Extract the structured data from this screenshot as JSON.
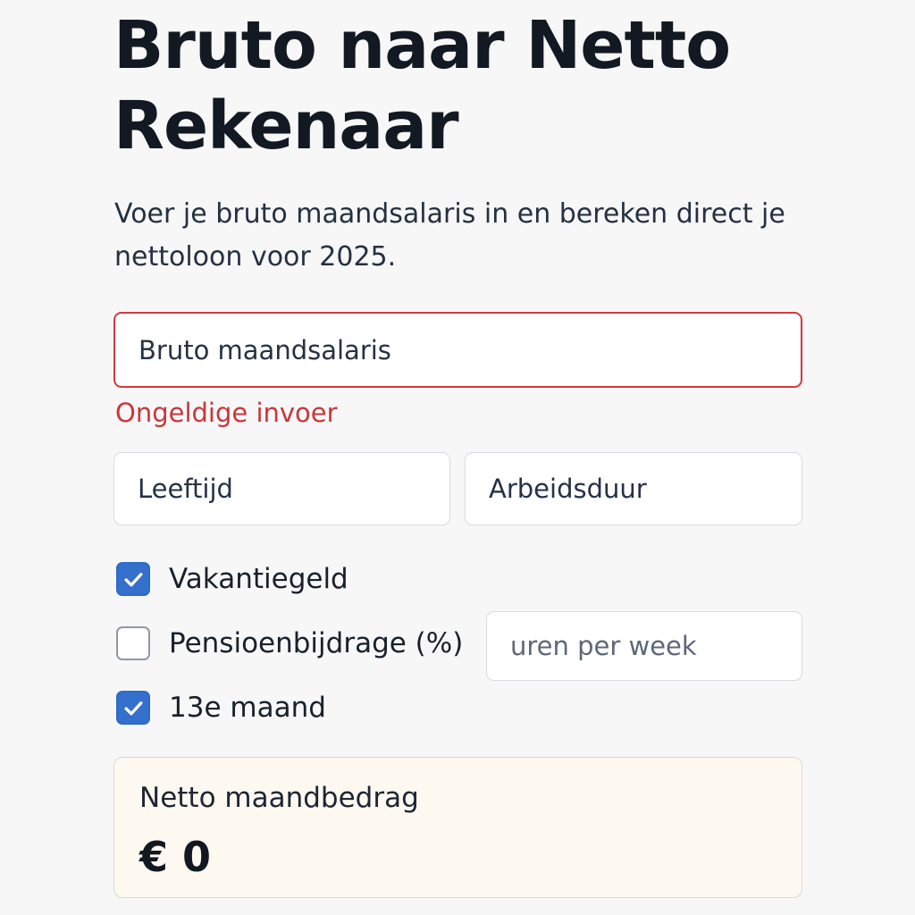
{
  "header": {
    "title": "Bruto naar Netto Rekenaar",
    "subtitle": "Voer je bruto maandsalaris in en bereken direct je nettoloon voor 2025."
  },
  "form": {
    "gross_salary": {
      "placeholder": "Bruto maandsalaris",
      "state": "error",
      "error_message": "Ongeldige invoer"
    },
    "age": {
      "placeholder": "Leeftijd"
    },
    "work_duration": {
      "placeholder": "Arbeidsduur"
    },
    "hours_per_week": {
      "placeholder": "uren per week"
    },
    "options": {
      "holiday_pay": {
        "label": "Vakantiegeld",
        "checked": true
      },
      "pension_contribution": {
        "label": "Pensioenbijdrage (%)",
        "checked": false
      },
      "thirteenth_month": {
        "label": "13e maand",
        "checked": true
      }
    }
  },
  "result": {
    "label": "Netto maandbedrag",
    "value": "€ 0"
  },
  "colors": {
    "error": "#d3393d",
    "checkbox_checked": "#356fcc",
    "result_background": "#fdf9f1"
  }
}
